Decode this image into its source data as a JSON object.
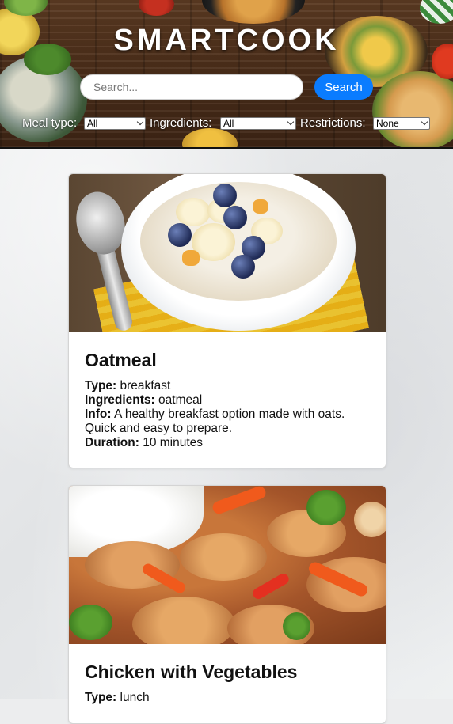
{
  "header": {
    "title": "SMARTCOOK",
    "search": {
      "placeholder": "Search...",
      "button_label": "Search"
    },
    "filters": {
      "meal_type": {
        "label": "Meal type:",
        "value": "All"
      },
      "ingredients": {
        "label": "Ingredients:",
        "value": "All"
      },
      "restrictions": {
        "label": "Restrictions:",
        "value": "None"
      }
    }
  },
  "labels": {
    "type": "Type:",
    "ingredients": "Ingredients:",
    "info": "Info:",
    "duration": "Duration:"
  },
  "recipes": [
    {
      "name": "Oatmeal",
      "type": "breakfast",
      "ingredients": "oatmeal",
      "info": "A healthy breakfast option made with oats. Quick and easy to prepare.",
      "duration": "10 minutes"
    },
    {
      "name": "Chicken with Vegetables",
      "type": "lunch"
    }
  ],
  "colors": {
    "accent": "#0a7cff",
    "header_wood": "#4a2d19"
  }
}
